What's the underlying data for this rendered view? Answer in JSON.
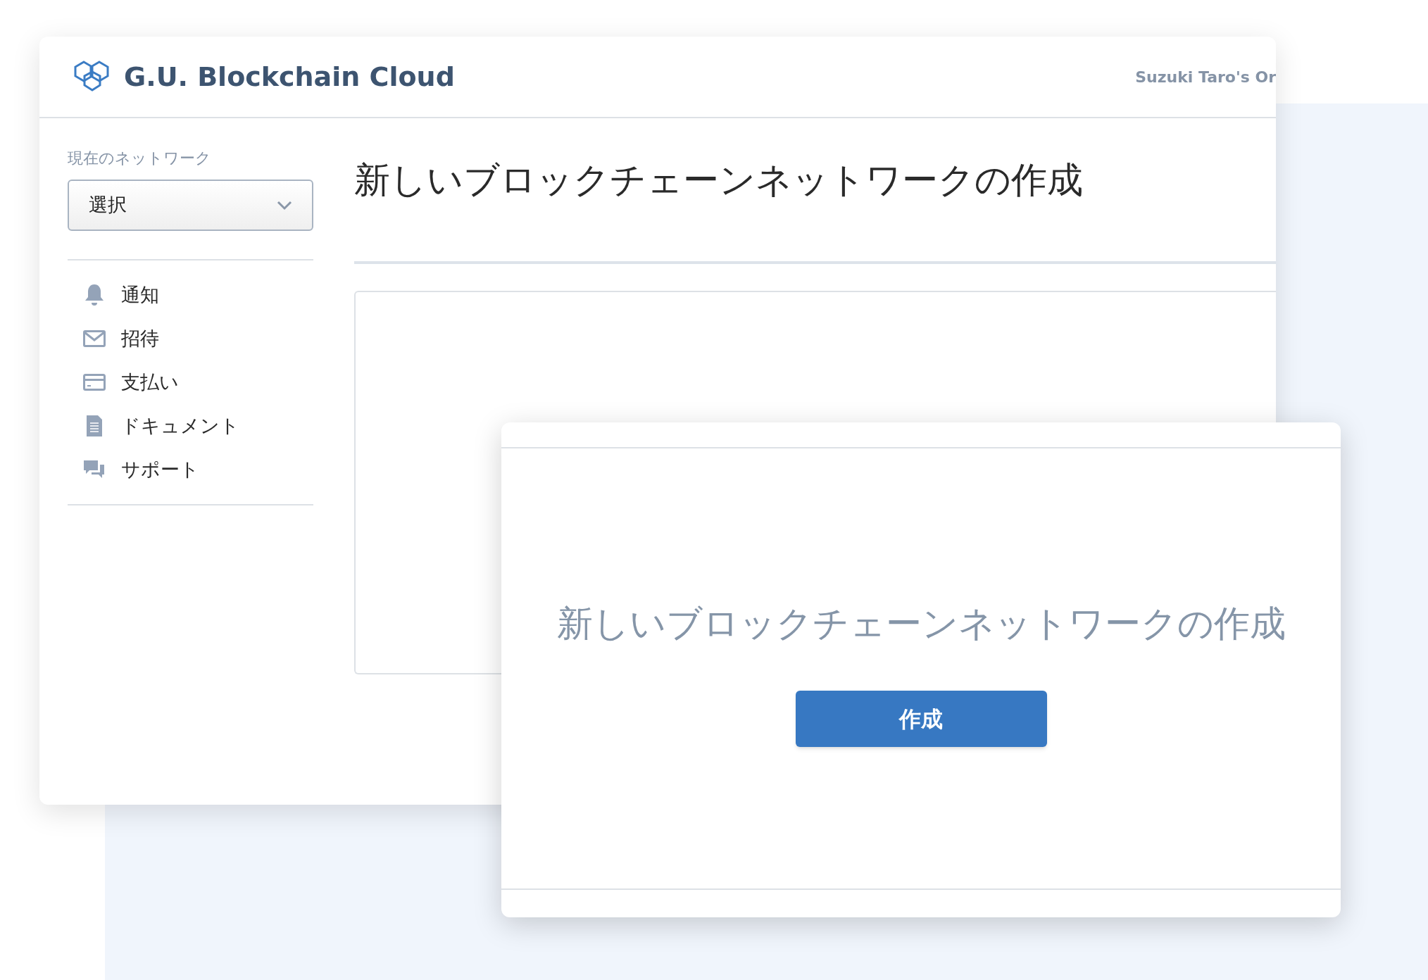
{
  "header": {
    "logo_text": "G.U. Blockchain Cloud",
    "account": "Suzuki Taro's Or"
  },
  "sidebar": {
    "network_label": "現在のネットワーク",
    "network_select": {
      "value": "選択"
    },
    "items": [
      {
        "kind": "bell",
        "label": "通知"
      },
      {
        "kind": "mail",
        "label": "招待"
      },
      {
        "kind": "card",
        "label": "支払い"
      },
      {
        "kind": "document",
        "label": "ドキュメント"
      },
      {
        "kind": "chat",
        "label": "サポート"
      }
    ]
  },
  "main": {
    "title": "新しいブロックチェーンネットワークの作成"
  },
  "modal": {
    "title": "新しいブロックチェーンネットワークの作成",
    "button": "作成"
  }
}
